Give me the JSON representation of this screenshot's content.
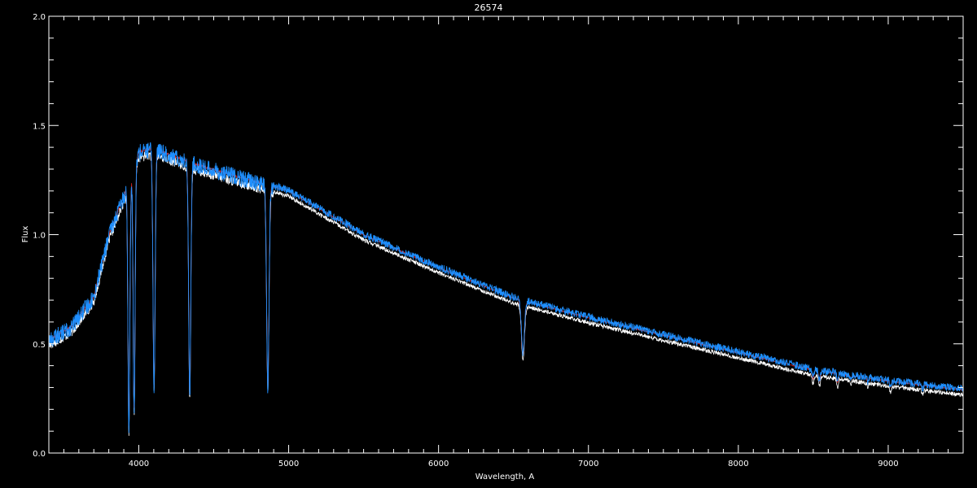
{
  "chart_data": {
    "type": "line",
    "title": "26574",
    "xlabel": "Wavelength, A",
    "ylabel": "Flux",
    "xlim": [
      3400,
      9500
    ],
    "ylim": [
      0.0,
      2.0
    ],
    "x_ticks": [
      4000,
      5000,
      6000,
      7000,
      8000,
      9000
    ],
    "x_tick_labels": [
      "4000",
      "5000",
      "6000",
      "7000",
      "8000",
      "9000"
    ],
    "y_ticks": [
      0.0,
      0.5,
      1.0,
      1.5,
      2.0
    ],
    "y_tick_labels": [
      "0.0",
      "0.5",
      "1.0",
      "1.5",
      "2.0"
    ],
    "grid": false,
    "colors": {
      "background": "#000000",
      "axes": "#ffffff",
      "series_white": "#ffffff",
      "series_red": "#cc2222",
      "series_blue": "#1e8fff"
    },
    "continuum": {
      "x": [
        3400,
        3550,
        3700,
        3800,
        3900,
        4000,
        4100,
        4200,
        4400,
        4600,
        4800,
        5000,
        5200,
        5500,
        6000,
        6500,
        7000,
        7500,
        8000,
        8500,
        9000,
        9500
      ],
      "y": [
        0.52,
        0.58,
        0.72,
        1.0,
        1.18,
        1.38,
        1.4,
        1.37,
        1.32,
        1.28,
        1.24,
        1.2,
        1.12,
        1.0,
        0.85,
        0.71,
        0.62,
        0.54,
        0.46,
        0.38,
        0.33,
        0.29
      ]
    },
    "absorption_lines": [
      {
        "x": 3934,
        "depth": 0.9,
        "width": 9
      },
      {
        "x": 3969,
        "depth": 0.85,
        "width": 9
      },
      {
        "x": 4102,
        "depth": 0.78,
        "width": 10
      },
      {
        "x": 4340,
        "depth": 0.8,
        "width": 10
      },
      {
        "x": 4861,
        "depth": 0.75,
        "width": 11
      },
      {
        "x": 6563,
        "depth": 0.35,
        "width": 14
      },
      {
        "x": 8498,
        "depth": 0.1,
        "width": 8
      },
      {
        "x": 8542,
        "depth": 0.12,
        "width": 8
      },
      {
        "x": 8662,
        "depth": 0.11,
        "width": 8
      },
      {
        "x": 8750,
        "depth": 0.05,
        "width": 6
      },
      {
        "x": 8863,
        "depth": 0.06,
        "width": 6
      },
      {
        "x": 9015,
        "depth": 0.08,
        "width": 7
      },
      {
        "x": 9230,
        "depth": 0.07,
        "width": 7
      }
    ],
    "series": [
      {
        "color": "white",
        "offset": -0.02,
        "noise": 0.02
      },
      {
        "color": "red",
        "offset": 0.0,
        "noise": 0.005
      },
      {
        "color": "blue",
        "offset": 0.01,
        "noise": 0.035
      }
    ]
  }
}
